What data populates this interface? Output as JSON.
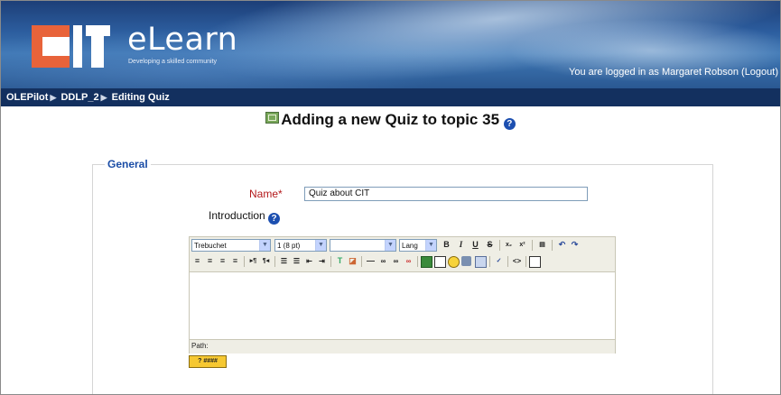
{
  "header": {
    "brand": "eLearn",
    "tagline": "Developing a skilled community",
    "login_info": "You are logged in as Margaret Robson (Logout)"
  },
  "breadcrumb": {
    "items": [
      "OLEPilot",
      "DDLP_2",
      "Editing Quiz"
    ],
    "separator": "▶"
  },
  "page": {
    "title": "Adding a new Quiz to topic 35"
  },
  "form": {
    "section_legend": "General",
    "name_label": "Name*",
    "name_value": "Quiz about CIT",
    "intro_label": "Introduction"
  },
  "editor": {
    "font_family": "Trebuchet",
    "font_size": "1 (8 pt)",
    "heading": "",
    "lang": "Lang",
    "path_label": "Path:",
    "help_btn": "? ####"
  },
  "colors": {
    "nav_bg": "#13305f",
    "accent_orange": "#e8633a",
    "legend_blue": "#1b4da6",
    "required_red": "#b3181a"
  }
}
